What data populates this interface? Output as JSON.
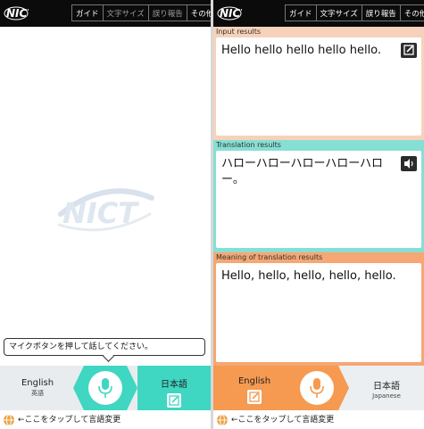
{
  "topbar": {
    "logo": "NICT",
    "menu": [
      "ガイド",
      "文字サイズ",
      "誤り報告",
      "その他"
    ]
  },
  "left": {
    "watermark": "NICT",
    "bubble_text": "マイクボタンを押して話してください。",
    "source_language": "English",
    "source_language_sub": "英語",
    "target_language": "日本語",
    "hint": "←ここをタップして言語変更",
    "colors": {
      "accent": "#3fd6c2",
      "bar_bg": "#e8ecef"
    }
  },
  "right": {
    "input_label": "Input results",
    "input_text": "Hello hello hello hello hello.",
    "translation_label": "Translation results",
    "translation_text": "ハローハローハローハローハロー。",
    "meaning_label": "Meaning of translation results",
    "meaning_text": "Hello, hello, hello, hello, hello.",
    "source_language": "English",
    "target_language": "日本語",
    "target_language_sub": "Japanese",
    "hint": "←ここをタップして言語変更",
    "colors": {
      "input": "#f7d2bb",
      "translation": "#86dfd4",
      "meaning": "#f6a774",
      "accent_orange": "#f59a50",
      "bar_bg": "#eceff1"
    }
  },
  "icons": [
    "nict-logo",
    "edit-icon",
    "microphone-icon",
    "speaker-icon",
    "globe-icon"
  ]
}
